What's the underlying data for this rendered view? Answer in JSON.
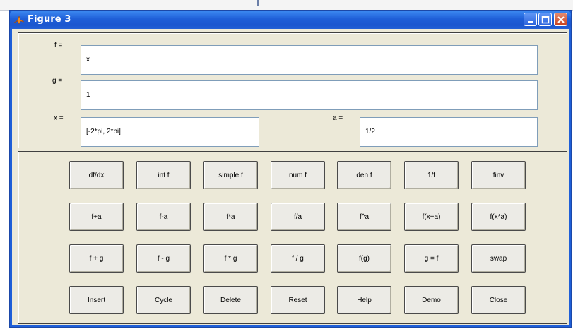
{
  "window": {
    "title": "Figure 3",
    "icon": "matlab-icon",
    "controls": [
      "minimize-icon",
      "maximize-icon",
      "close-icon"
    ]
  },
  "inputs": {
    "f_label": "f =",
    "f_value": "x",
    "g_label": "g =",
    "g_value": "1",
    "x_label": "x =",
    "x_value": "[-2*pi, 2*pi]",
    "a_label": "a =",
    "a_value": "1/2"
  },
  "buttons": [
    [
      "df/dx",
      "int f",
      "simple f",
      "num f",
      "den f",
      "1/f",
      "finv"
    ],
    [
      "f+a",
      "f-a",
      "f*a",
      "f/a",
      "f^a",
      "f(x+a)",
      "f(x*a)"
    ],
    [
      "f + g",
      "f - g",
      "f * g",
      "f / g",
      "f(g)",
      "g = f",
      "swap"
    ],
    [
      "Insert",
      "Cycle",
      "Delete",
      "Reset",
      "Help",
      "Demo",
      "Close"
    ]
  ],
  "colors": {
    "titlebar": "#1f5fd8",
    "client_bg": "#ece9d8",
    "close_button": "#c8401d"
  }
}
